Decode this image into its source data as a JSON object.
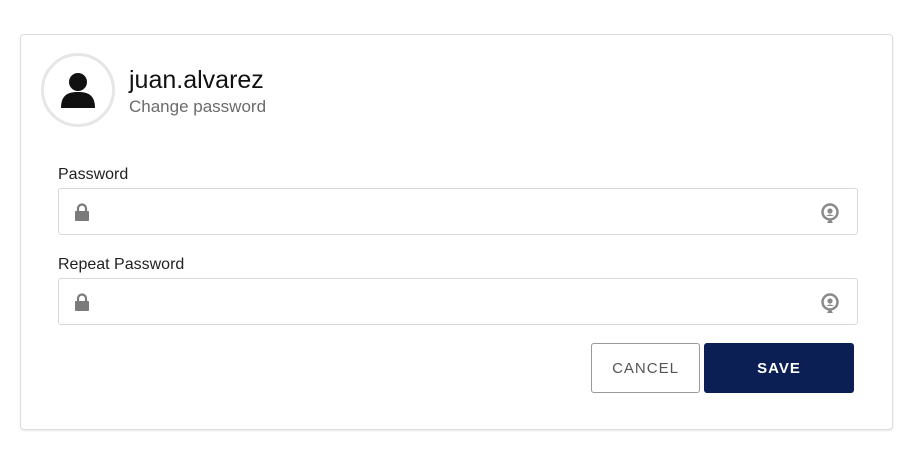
{
  "profile": {
    "username": "juan.alvarez",
    "subtitle": "Change password"
  },
  "form": {
    "password_label": "Password",
    "password_value": "",
    "repeat_label": "Repeat Password",
    "repeat_value": ""
  },
  "actions": {
    "cancel_label": "CANCEL",
    "save_label": "SAVE"
  },
  "icons": {
    "avatar": "user-silhouette-icon",
    "field_prefix": "lock-icon",
    "field_suffix": "eye-reveal-icon"
  },
  "colors": {
    "primary": "#0c1f55",
    "border": "#d9d9d9",
    "icon": "#7a7a7a"
  }
}
